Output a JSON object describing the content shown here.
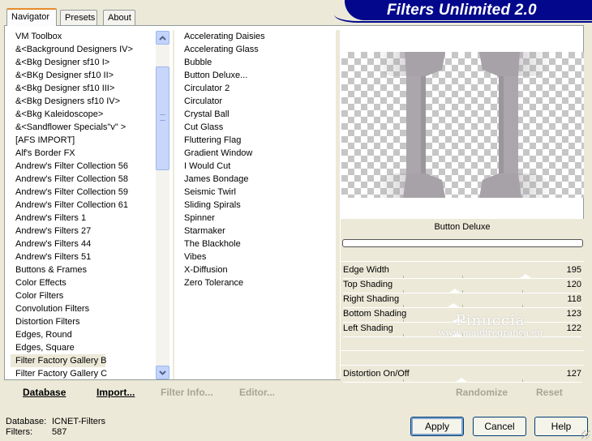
{
  "banner": {
    "title": "Filters Unlimited 2.0"
  },
  "tabs": [
    {
      "label": "Navigator",
      "active": true
    },
    {
      "label": "Presets",
      "active": false
    },
    {
      "label": "About",
      "active": false
    }
  ],
  "categories": [
    "VM Toolbox",
    "&<Background Designers IV>",
    "&<Bkg Designer sf10 I>",
    "&<BKg Designer sf10 II>",
    "&<Bkg Designer sf10 III>",
    "&<Bkg Designers sf10 IV>",
    "&<Bkg Kaleidoscope>",
    "&<Sandflower Specials\"v\" >",
    "[AFS IMPORT]",
    "Alf's Border FX",
    "Andrew's Filter Collection 56",
    "Andrew's Filter Collection 58",
    "Andrew's Filter Collection 59",
    "Andrew's Filter Collection 61",
    "Andrew's Filters 1",
    "Andrew's Filters 27",
    "Andrew's Filters 44",
    "Andrew's Filters 51",
    "Buttons & Frames",
    "Color Effects",
    "Color Filters",
    "Convolution Filters",
    "Distortion Filters",
    "Edges, Round",
    "Edges, Square",
    "Filter Factory Gallery B",
    "Filter Factory Gallery C"
  ],
  "selected_category": "Filter Factory Gallery B",
  "filters": [
    "Accelerating Daisies",
    "Accelerating Glass",
    "Bubble",
    "Button Deluxe...",
    "Circulator 2",
    "Circulator",
    "Crystal Ball",
    "Cut Glass",
    "Fluttering Flag",
    "Gradient Window",
    "I Would Cut",
    "James Bondage",
    "Seismic Twirl",
    "Sliding Spirals",
    "Spinner",
    "Starmaker",
    "The Blackhole",
    "Vibes",
    "X-Diffusion",
    "Zero Tolerance"
  ],
  "toolbar": {
    "database": "Database",
    "import": "Import...",
    "filter_info": "Filter Info...",
    "editor": "Editor..."
  },
  "params_panel": {
    "filter_name": "Button Deluxe",
    "randomize": "Randomize",
    "reset": "Reset"
  },
  "params": [
    {
      "label": "Edge Width",
      "value": "195",
      "level": 0.765
    },
    {
      "label": "Top Shading",
      "value": "120",
      "level": 0.47
    },
    {
      "label": "Right Shading",
      "value": "118",
      "level": 0.463
    },
    {
      "label": "Bottom Shading",
      "value": "123",
      "level": 0.482
    },
    {
      "label": "Left Shading",
      "value": "122",
      "level": 0.478
    }
  ],
  "distortion": {
    "label": "Distortion On/Off",
    "value": "127",
    "level": 0.498
  },
  "watermark": {
    "title": "Pinuccia",
    "subtitle": "www.maidiregrafica.eu"
  },
  "status": {
    "database_label": "Database:",
    "database_value": "ICNET-Filters",
    "filters_label": "Filters:",
    "filters_value": "587"
  },
  "buttons": {
    "apply": "Apply",
    "cancel": "Cancel",
    "help": "Help"
  },
  "colors": {
    "banner_bg": "#02078c",
    "tab_highlight": "#e68b2c",
    "dialog_bg": "#ece9d8",
    "scrollbar": "#c3d3fd",
    "preview_bar": "#a7a2a7"
  },
  "icons": {
    "scroll_up": "chevron-up-icon",
    "scroll_down": "chevron-down-icon"
  }
}
